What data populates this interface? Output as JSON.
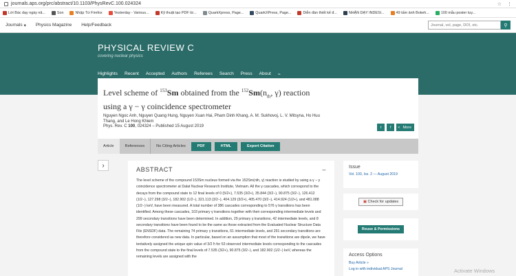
{
  "browser": {
    "url": "journals.aps.org/prc/abstract/10.1103/PhysRevC.100.024324",
    "bookmarks": [
      "Lời Bác dạy ngày nă...",
      "Son",
      "Nhập Từ Firefox",
      "Yesterday - Various...",
      "Kỹ thuật tạo PDF từ...",
      "QuarkXpress, Page...",
      "QuarkXPress, Page...",
      "Diễn đàn thiết kế đ...",
      "NHẬN DẠY INDESI...",
      "49 tấm ảnh Bokeh...",
      "100 mẫu poster tuy..."
    ],
    "bookmark_colors": [
      "#c0392b",
      "#555555",
      "#e67e22",
      "#e74c3c",
      "#c0392b",
      "#7f8c8d",
      "#34495e",
      "#c0392b",
      "#2c3e50",
      "#e67e22",
      "#27ae60"
    ]
  },
  "topnav": {
    "journals": "Journals",
    "physics_magazine": "Physics Magazine",
    "help": "Help/Feedback",
    "search_placeholder": "Journal, vol, page, DOI, etc."
  },
  "banner": {
    "title": "PHYSICAL REVIEW C",
    "subtitle": "covering nuclear physics",
    "nav": [
      "Highlights",
      "Recent",
      "Accepted",
      "Authors",
      "Referees",
      "Search",
      "Press",
      "About"
    ]
  },
  "article": {
    "title_line1_a": "Level scheme of ",
    "title_sup1": "153",
    "title_sm1": "Sm",
    "title_line1_b": " obtained from the ",
    "title_sup2": "152",
    "title_sm2": "Sm",
    "title_reaction": "(n",
    "title_sub": "th",
    "title_reaction2": ", γ)",
    "title_line1_c": " reaction",
    "title_line2": "using a γ − γ coincidence spectrometer",
    "authors": "Nguyen Ngoc Anh, Nguyen Quang Hung, Nguyen Xuan Hai, Pham Dinh Khang, A. M. Sukhovoj, L. V. Mitsyna, Ho Huu Thang, and Le Hong Khiem",
    "journal_ref_a": "Phys. Rev. C ",
    "journal_ref_vol": "100",
    "journal_ref_b": ", 024324 – Published 15 August 2019",
    "share_more": "More"
  },
  "tabs": {
    "article": "Article",
    "references": "References",
    "citing": "No Citing Articles",
    "pdf": "PDF",
    "html": "HTML",
    "export": "Export Citation"
  },
  "abstract": {
    "heading": "ABSTRACT",
    "collapse": "–",
    "p1": "The level scheme of the compound 153Sm nucleus formed via the 152Sm(nth, γ) reaction is studied by using a γ − γ coincidence spectrometer at Dalat Nuclear Research Institute, Vietnam. All the γ cascades, which correspond to the decays from the compound state to 12 final levels of 0 (5/2+), 7.535 (3/2+), 35.844 (3/2−), 90.875 (3/2−), 126.412 (1/2−), 127.298 (3/2−), 182.902 (1/2−), 321.113 (3/2−), 404.129 (3/2+), 405.470 (3/2−), 414.924 (1/2+), and 481.088 (1/2−) keV, have been measured. A total number of 386 cascades corresponding to 576 γ transitions has been identified. Among these cascades, 103 primary γ transitions together with their corresponding intermediate levels and 299 secondary transitions have been determined. In addition, 29 primary γ transitions, 42 intermediate levels, and 8 secondary transitions have been found to be the same as those extracted from the Evaluated Nuclear Structure Data File (ENSDF) data. The remaining 74 primary γ transitions, 61 intermediate levels, and 291 secondary transitions are therefore considered as new data. In particular, based on an assumption that most of the transitions are dipole, we have tentatively assigned the unique spin value of 3/2 ħ for 53 observed intermediate levels corresponding to the cascades from the compound state to the final levels of 7.535 (3/2+), 90.875 (3/2−), and 182.902 (1/2−) keV, whereas the remaining levels are assigned with the"
  },
  "sidebar": {
    "issue_heading": "Issue",
    "issue_value": "Vol. 100, Iss. 2 — August 2019",
    "check_updates": "Check for updates",
    "reuse": "Reuse & Permissions",
    "access_heading": "Access Options",
    "buy_article": "Buy Article »",
    "login": "Log in with individual APS Journal"
  },
  "os": {
    "watermark": "Activate Windows"
  },
  "colors": {
    "accent": "#247b74",
    "banner": "#2b6c68",
    "link": "#1b63a8"
  }
}
